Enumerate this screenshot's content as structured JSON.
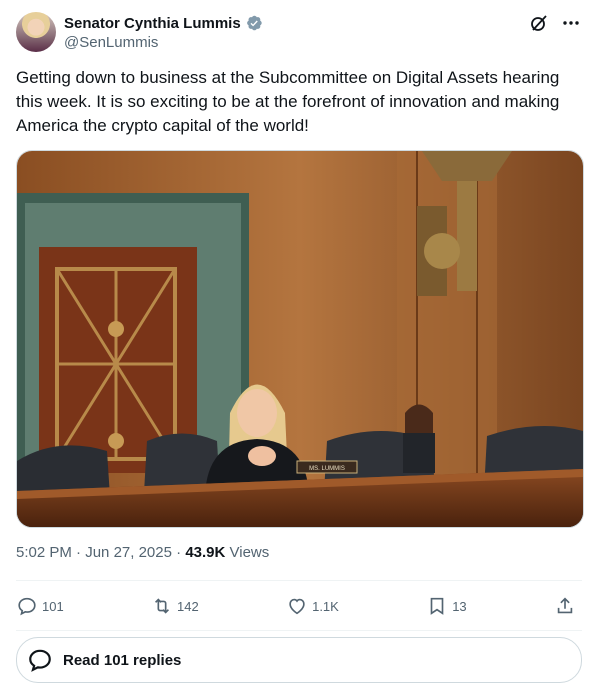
{
  "author": {
    "name": "Senator Cynthia Lummis",
    "handle": "@SenLummis"
  },
  "tweet": {
    "text": "Getting down to business at the Subcommittee on Digital Assets hearing this week. It is so exciting to be at the forefront of innovation and making America the crypto capital of the world!",
    "nameplate": "MS. LUMMIS"
  },
  "meta": {
    "time": "5:02 PM",
    "separator": "·",
    "date": "Jun 27, 2025",
    "views_count": "43.9K",
    "views_label": "Views"
  },
  "actions": {
    "replies": "101",
    "reposts": "142",
    "likes": "1.1K",
    "bookmarks": "13"
  },
  "read_replies_label": "Read 101 replies",
  "colors": {
    "verified": "#829aab",
    "text_secondary": "#536471",
    "border": "#cfd9de"
  }
}
